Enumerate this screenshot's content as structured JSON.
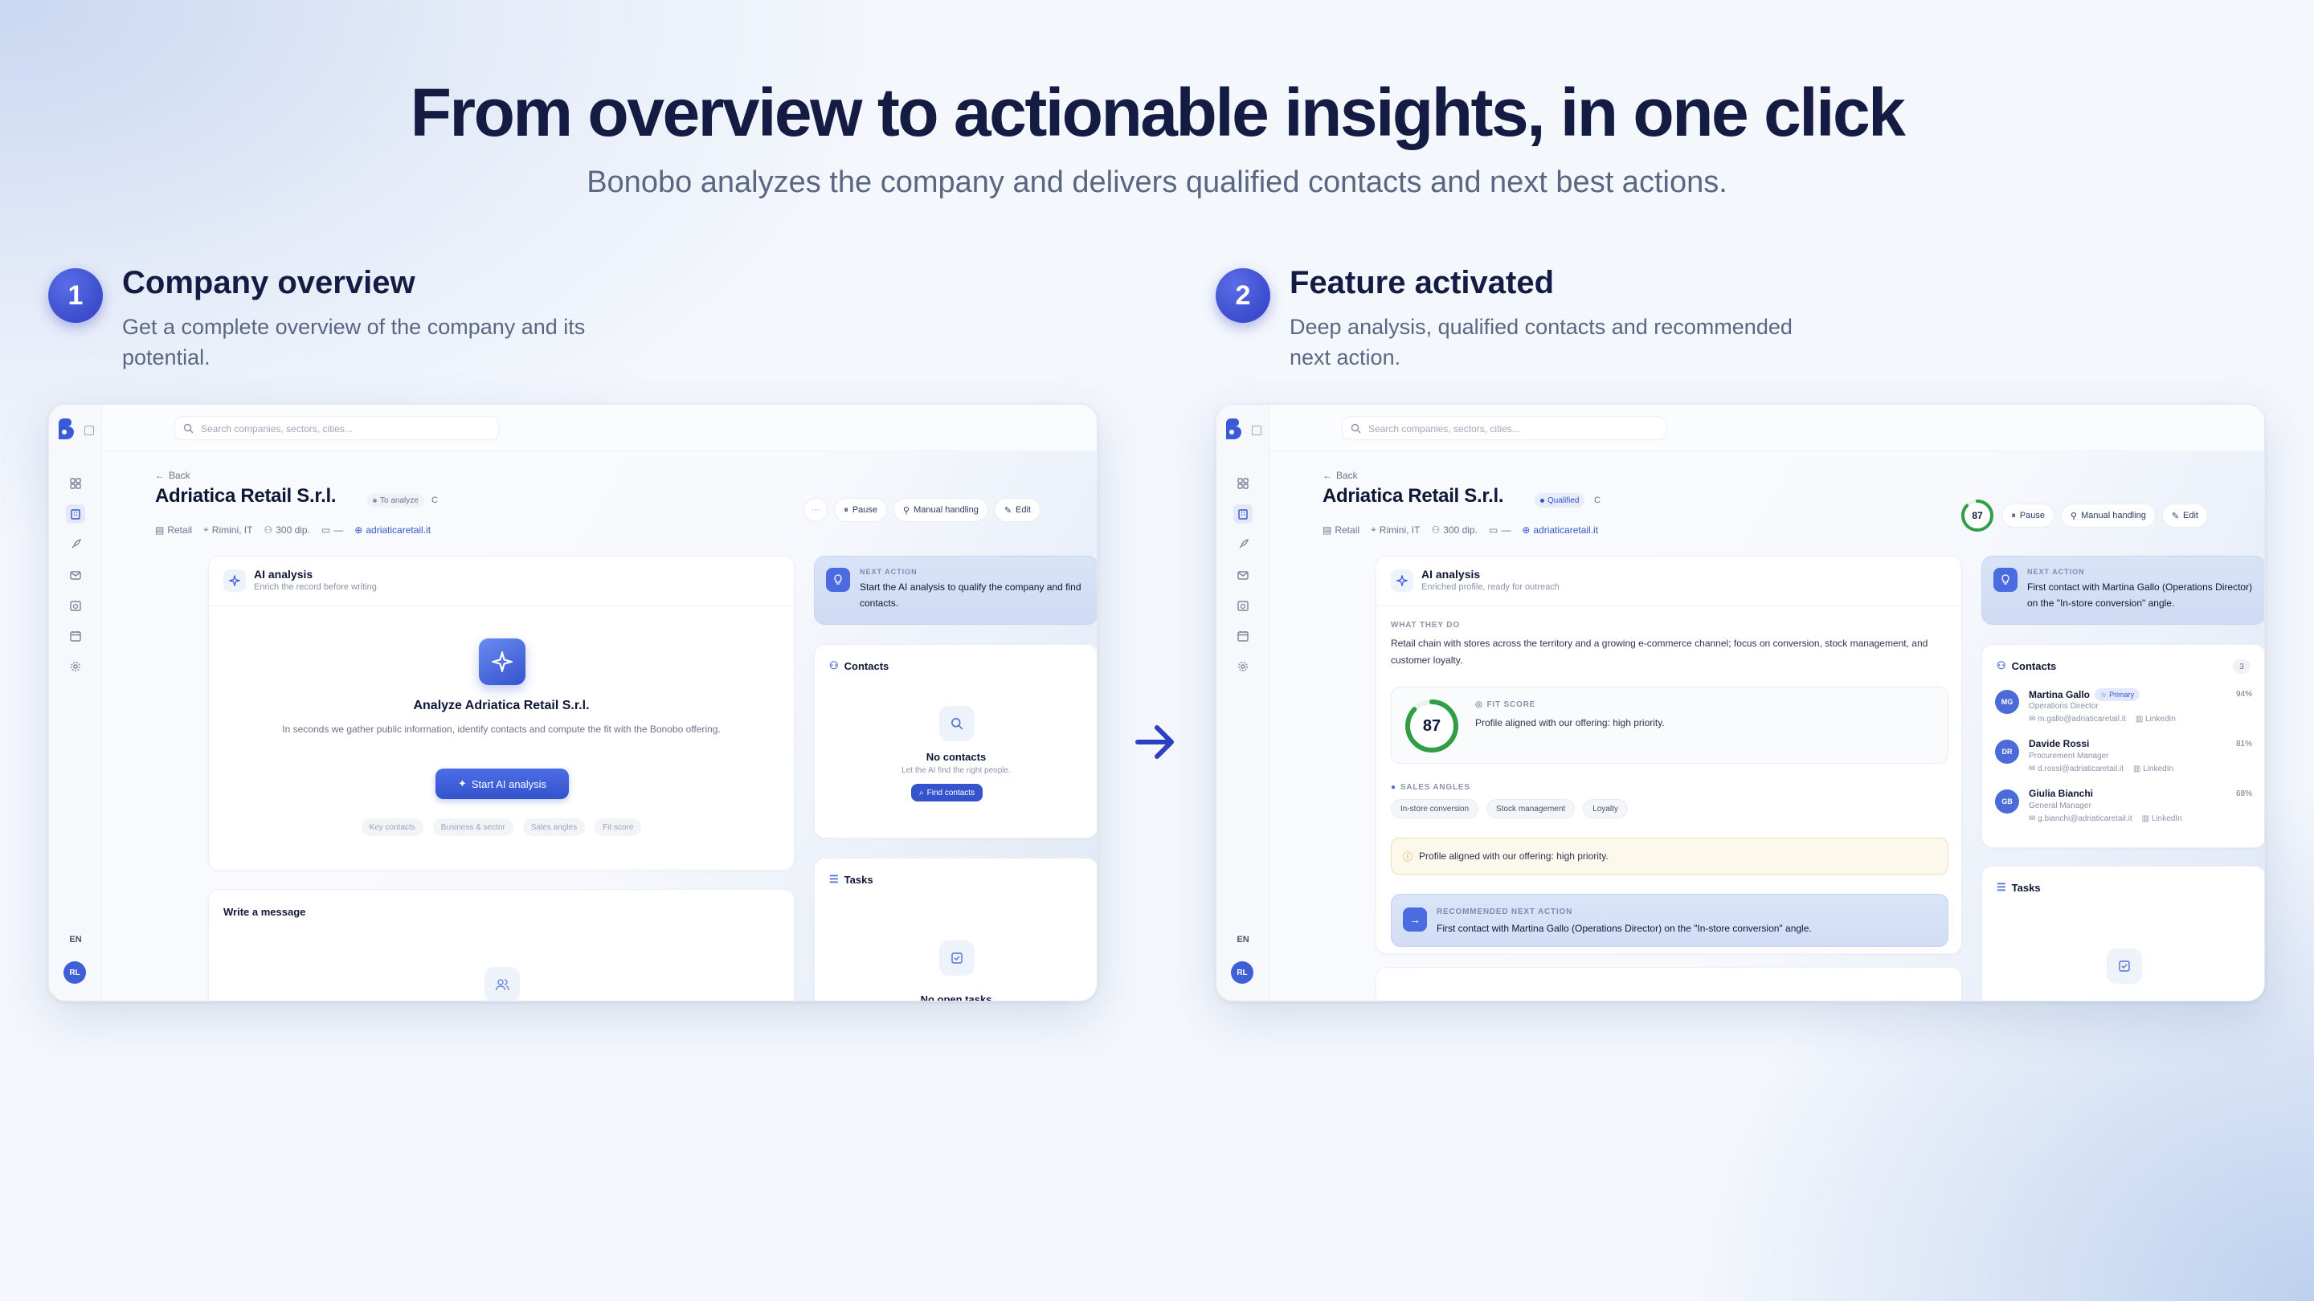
{
  "hero": {
    "title": "From overview to actionable insights, in one click",
    "subtitle": "Bonobo analyzes the company and delivers qualified contacts and next best actions."
  },
  "steps": [
    {
      "number": "1",
      "title": "Company overview",
      "description": "Get a complete overview of the company and its potential."
    },
    {
      "number": "2",
      "title": "Feature activated",
      "description": "Deep analysis, qualified contacts and recommended next action."
    }
  ],
  "arrow_icon": "arrow-right-icon",
  "colors": {
    "accent": "#3453cc",
    "title": "#141c43",
    "score_green": "#2f9e44",
    "warning_bg": "#fdf8ec"
  },
  "nav_icons": [
    "dashboard-icon",
    "building-icon",
    "rocket-icon",
    "mail-icon",
    "calendar-clock-icon",
    "calendar-icon",
    "gear-icon"
  ],
  "common": {
    "search_placeholder": "Search companies, sectors, cities...",
    "back": "Back",
    "company_name": "Adriatica Retail S.r.l.",
    "grade": "C",
    "meta": {
      "sector": "Retail",
      "location": "Rimini, IT",
      "employees": "300 dip.",
      "revenue": "—",
      "website": "adriaticaretail.it"
    },
    "actions": {
      "more": "···",
      "pause": "Pause",
      "manual": "Manual handling",
      "edit": "Edit"
    },
    "language": "EN",
    "avatar": "RL",
    "ai_title": "AI analysis",
    "contacts_title": "Contacts",
    "tasks_title": "Tasks",
    "next_action_label": "NEXT ACTION"
  },
  "before": {
    "status": "To analyze",
    "ai_subtitle": "Enrich the record before writing",
    "analyze_title": "Analyze Adriatica Retail S.r.l.",
    "analyze_desc": "In seconds we gather public information, identify contacts and compute the fit with the Bonobo offering.",
    "start_button": "Start AI analysis",
    "tags": [
      "Key contacts",
      "Business & sector",
      "Sales angles",
      "Fit score"
    ],
    "next_action": "Start the AI analysis to qualify the company and find contacts.",
    "no_contacts": "No contacts",
    "no_contacts_sub": "Let the AI find the right people.",
    "find_contacts": "Find contacts",
    "write_message": "Write a message",
    "no_tasks": "No open tasks"
  },
  "after": {
    "status": "Qualified",
    "score": "87",
    "ai_subtitle": "Enriched profile, ready for outreach",
    "what_they_do_label": "WHAT THEY DO",
    "what_they_do": "Retail chain with stores across the territory and a growing e-commerce channel; focus on conversion, stock management, and customer loyalty.",
    "fit_score_label": "FIT SCORE",
    "fit_score_value": 87,
    "fit_text": "Profile aligned with our offering: high priority.",
    "sales_angles_label": "SALES ANGLES",
    "sales_angles": [
      "In-store conversion",
      "Stock management",
      "Loyalty"
    ],
    "warning": "Profile aligned with our offering: high priority.",
    "rec_label": "RECOMMENDED NEXT ACTION",
    "rec_text": "First contact with Martina Gallo (Operations Director) on the \"In-store conversion\" angle.",
    "next_action": "First contact with Martina Gallo (Operations Director) on the \"In-store conversion\" angle.",
    "contacts_count": "3",
    "contacts": [
      {
        "initials": "MG",
        "name": "Martina Gallo",
        "badge": "Primary",
        "role": "Operations Director",
        "email": "m.gallo@adriaticaretail.it",
        "linkedin": "LinkedIn",
        "pct": "94%"
      },
      {
        "initials": "DR",
        "name": "Davide Rossi",
        "badge": "",
        "role": "Procurement Manager",
        "email": "d.rossi@adriaticaretail.it",
        "linkedin": "LinkedIn",
        "pct": "81%"
      },
      {
        "initials": "GB",
        "name": "Giulia Bianchi",
        "badge": "",
        "role": "General Manager",
        "email": "g.bianchi@adriaticaretail.it",
        "linkedin": "LinkedIn",
        "pct": "68%"
      }
    ]
  }
}
